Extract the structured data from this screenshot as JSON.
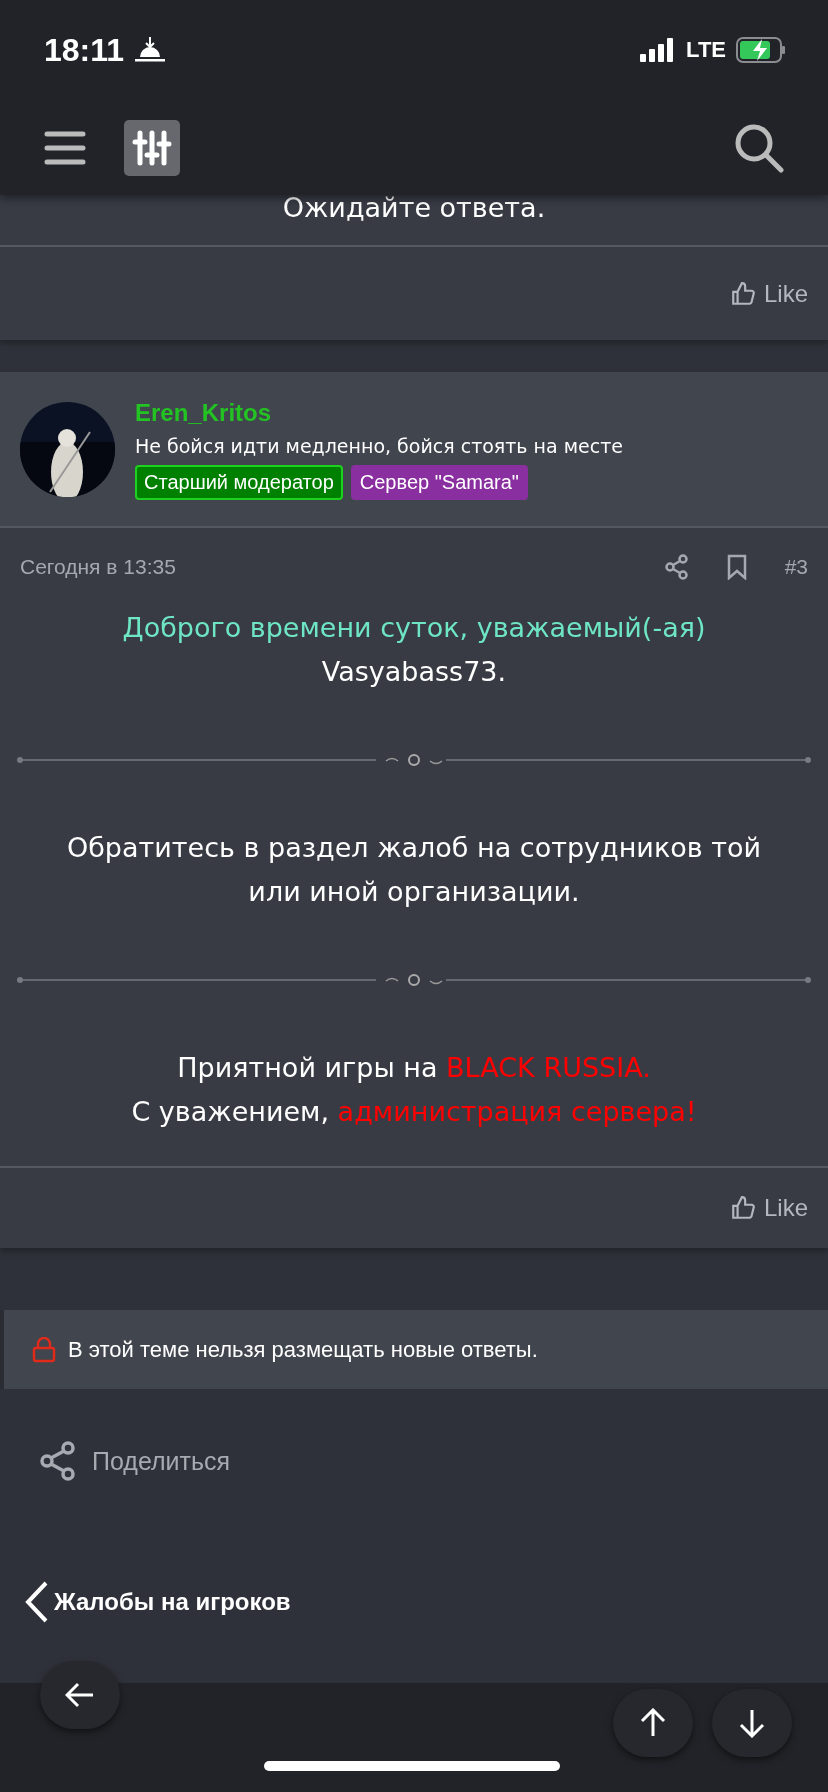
{
  "status_bar": {
    "time": "18:11",
    "network": "LTE"
  },
  "previous_post": {
    "text": "Ожидайте ответа.",
    "like_label": "Like"
  },
  "post": {
    "author": {
      "name": "Eren_Kritos",
      "signature": "Не бойся идти медленно, бойся стоять на месте",
      "badges": [
        {
          "label": "Старший модератор",
          "color": "#008000"
        },
        {
          "label": "Сервер \"Samara\"",
          "color": "#8a2fa0"
        }
      ]
    },
    "date": "Сегодня в 13:35",
    "number": "#3",
    "body": [
      {
        "kind": "text",
        "lines": [
          [
            {
              "text": "Доброго времени суток, уважаемый(-ая)",
              "color": "#6ee6c4"
            }
          ],
          [
            {
              "text": "Vasyabass73.",
              "color": "#ffffff"
            }
          ]
        ]
      },
      {
        "kind": "divider"
      },
      {
        "kind": "text",
        "lines": [
          [
            {
              "text": "Обратитесь в раздел жалоб на сотрудников той",
              "color": "#ffffff"
            }
          ],
          [
            {
              "text": "или иной организации.",
              "color": "#ffffff"
            }
          ]
        ]
      },
      {
        "kind": "divider"
      },
      {
        "kind": "text",
        "lines": [
          [
            {
              "text": "Приятной игры на ",
              "color": "#ffffff"
            },
            {
              "text": "BLACK RUSSIA.",
              "color": "#ff0000"
            }
          ],
          [
            {
              "text": "С уважением, ",
              "color": "#ffffff"
            },
            {
              "text": "администрация сервера!",
              "color": "#ff0000"
            }
          ]
        ]
      }
    ],
    "like_label": "Like"
  },
  "notice": "В этой теме нельзя размещать новые ответы.",
  "share_label": "Поделиться",
  "breadcrumb": "Жалобы на игроков"
}
